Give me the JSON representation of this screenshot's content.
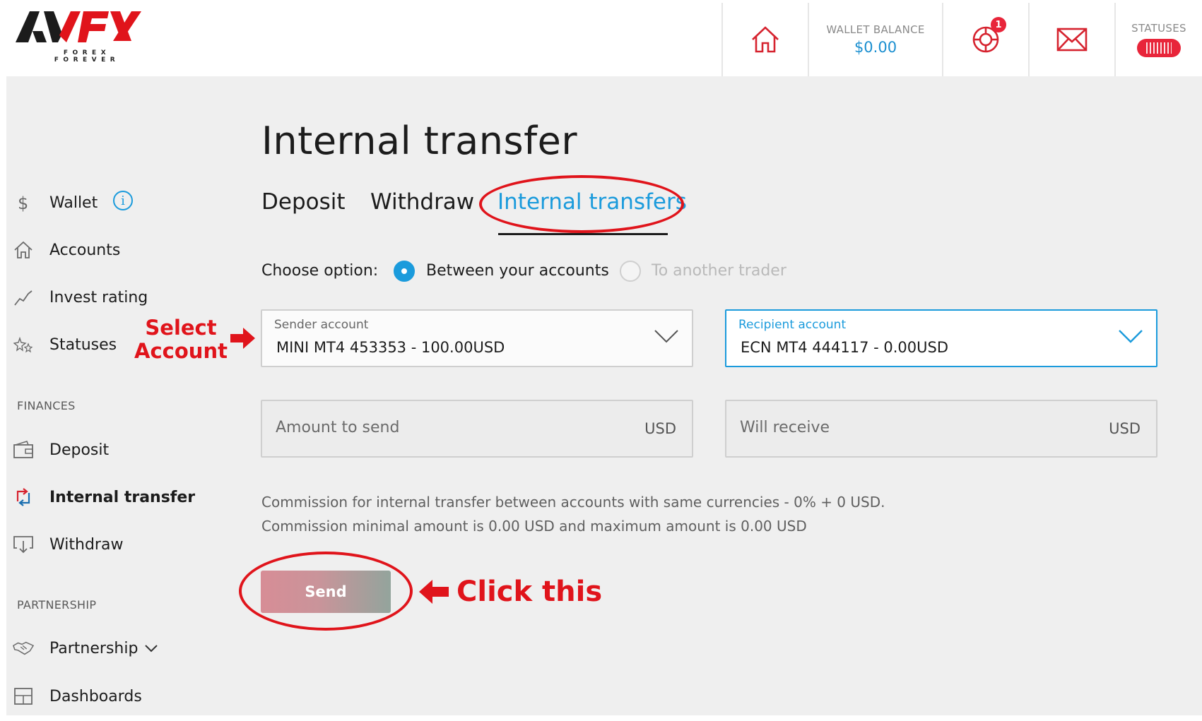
{
  "header": {
    "logo_text": "AVFX",
    "logo_tagline": "FOREX FOREVER",
    "wallet_caption": "WALLET BALANCE",
    "wallet_balance": "$0.00",
    "support_badge_count": "1",
    "statuses_caption": "STATUSES"
  },
  "sidebar": {
    "items_top": [
      {
        "label": "Wallet",
        "icon": "dollar-icon"
      },
      {
        "label": "Accounts",
        "icon": "home-icon"
      },
      {
        "label": "Invest rating",
        "icon": "chart-line-icon"
      },
      {
        "label": "Statuses",
        "icon": "stars-icon"
      }
    ],
    "wallet_info_icon": "i",
    "finances_heading": "FINANCES",
    "finances_items": [
      {
        "label": "Deposit",
        "icon": "wallet-icon"
      },
      {
        "label": "Internal transfer",
        "icon": "transfer-icon",
        "active": true
      },
      {
        "label": "Withdraw",
        "icon": "withdraw-icon"
      }
    ],
    "partnership_heading": "PARTNERSHIP",
    "partnership_items": [
      {
        "label": "Partnership",
        "icon": "handshake-icon"
      },
      {
        "label": "Dashboards",
        "icon": "dashboard-icon"
      }
    ]
  },
  "main": {
    "title": "Internal transfer",
    "tabs": [
      {
        "label": "Deposit"
      },
      {
        "label": "Withdraw"
      },
      {
        "label": "Internal transfers",
        "active": true
      }
    ],
    "choose_option_label": "Choose option:",
    "options": [
      {
        "label": "Between your accounts",
        "selected": true
      },
      {
        "label": "To another trader",
        "selected": false
      }
    ],
    "sender": {
      "caption": "Sender account",
      "value": "MINI MT4 453353 - 100.00USD"
    },
    "recipient": {
      "caption": "Recipient account",
      "value": "ECN MT4 444117 - 0.00USD"
    },
    "amount_to_send": {
      "placeholder": "Amount to send",
      "currency": "USD"
    },
    "will_receive": {
      "placeholder": "Will receive",
      "currency": "USD"
    },
    "commission_line1": "Commission for internal transfer between accounts with same currencies - 0% + 0 USD.",
    "commission_line2": "Commission minimal amount is 0.00 USD and maximum amount is 0.00 USD",
    "send_label": "Send"
  },
  "annotations": {
    "select_account": "Select Account",
    "click_this": "Click this",
    "color": "#e0141b"
  },
  "colors": {
    "accent": "#1b9bdc",
    "badge_red": "#e8253a",
    "background": "#efefef"
  }
}
